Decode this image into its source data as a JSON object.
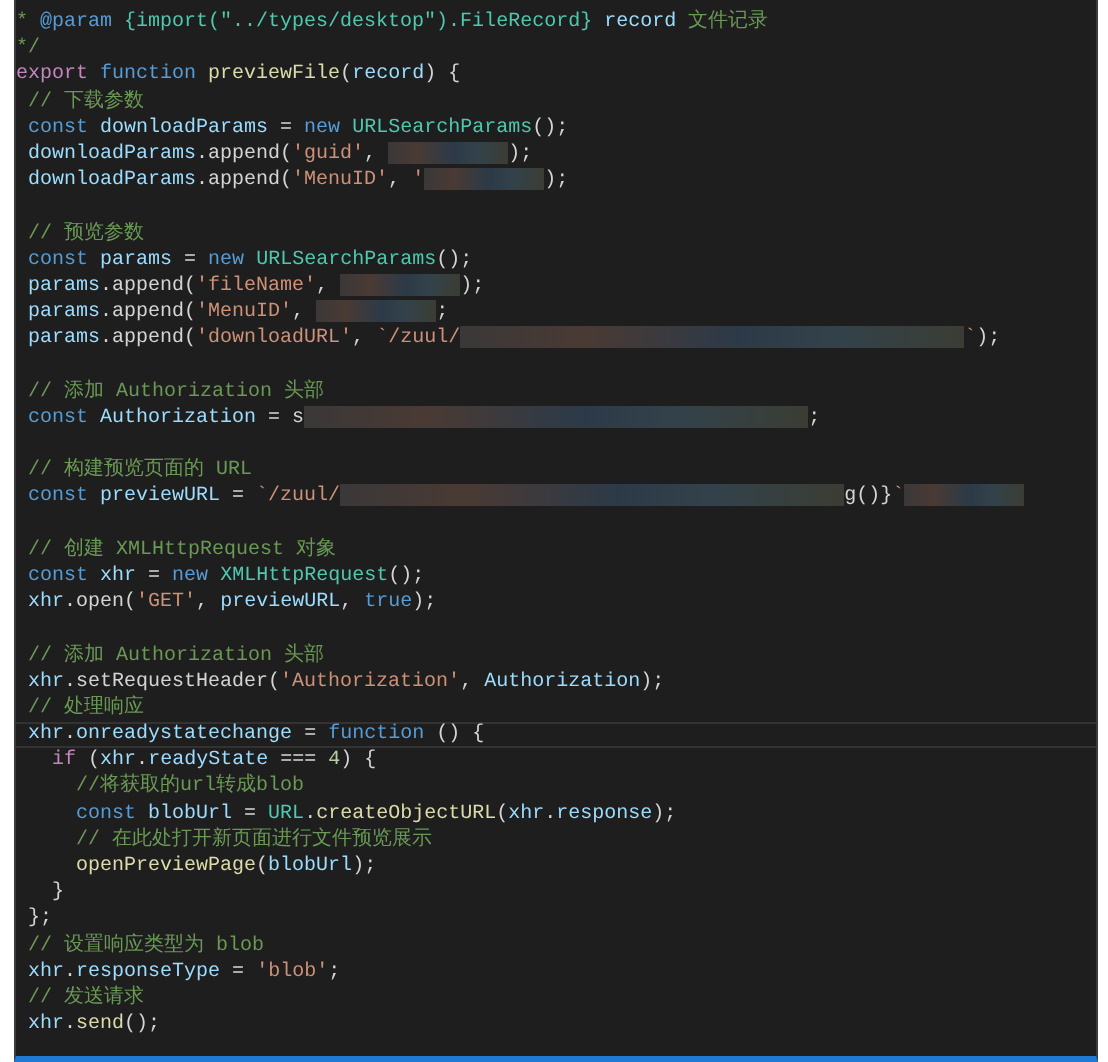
{
  "editor": {
    "lines": [
      {
        "kind": "code",
        "tokens": [
          {
            "kind": "c",
            "text": "* "
          },
          {
            "kind": "doc",
            "text": "@param"
          },
          {
            "kind": "type",
            "text": " {import(\"../types/desktop\").FileRecord}"
          },
          {
            "kind": "var",
            "text": " record"
          },
          {
            "kind": "c",
            "text": " 文件记录"
          }
        ]
      },
      {
        "kind": "code",
        "tokens": [
          {
            "kind": "c",
            "text": "*/"
          }
        ]
      },
      {
        "kind": "code",
        "tokens": [
          {
            "kind": "ctl",
            "text": "export"
          },
          {
            "kind": "kw",
            "text": " function"
          },
          {
            "kind": "fn",
            "text": " previewFile"
          },
          {
            "kind": "p",
            "text": "("
          },
          {
            "kind": "var",
            "text": "record"
          },
          {
            "kind": "p",
            "text": ") {"
          }
        ]
      },
      {
        "kind": "code",
        "tokens": [
          {
            "kind": "c",
            "text": " // 下载参数"
          }
        ]
      },
      {
        "kind": "code",
        "tokens": [
          {
            "kind": "kw",
            "text": " const"
          },
          {
            "kind": "var",
            "text": " downloadParams"
          },
          {
            "kind": "p",
            "text": " = "
          },
          {
            "kind": "kw",
            "text": "new"
          },
          {
            "kind": "cls",
            "text": " URLSearchParams"
          },
          {
            "kind": "p",
            "text": "();"
          }
        ]
      },
      {
        "kind": "code",
        "tokens": [
          {
            "kind": "var",
            "text": " downloadParams"
          },
          {
            "kind": "p",
            "text": ".append("
          },
          {
            "kind": "str",
            "text": "'guid'"
          },
          {
            "kind": "p",
            "text": ", "
          },
          {
            "kind": "blur"
          },
          {
            "kind": "p",
            "text": ");"
          }
        ]
      },
      {
        "kind": "code",
        "tokens": [
          {
            "kind": "var",
            "text": " downloadParams"
          },
          {
            "kind": "p",
            "text": ".append("
          },
          {
            "kind": "str",
            "text": "'MenuID'"
          },
          {
            "kind": "p",
            "text": ", "
          },
          {
            "kind": "str",
            "text": "'"
          },
          {
            "kind": "blur"
          },
          {
            "kind": "p",
            "text": ");"
          }
        ]
      },
      {
        "kind": "blank"
      },
      {
        "kind": "code",
        "tokens": [
          {
            "kind": "c",
            "text": " // 预览参数"
          }
        ]
      },
      {
        "kind": "code",
        "tokens": [
          {
            "kind": "kw",
            "text": " const"
          },
          {
            "kind": "var",
            "text": " params"
          },
          {
            "kind": "p",
            "text": " = "
          },
          {
            "kind": "kw",
            "text": "new"
          },
          {
            "kind": "cls",
            "text": " URLSearchParams"
          },
          {
            "kind": "p",
            "text": "();"
          }
        ]
      },
      {
        "kind": "code",
        "tokens": [
          {
            "kind": "var",
            "text": " params"
          },
          {
            "kind": "p",
            "text": ".append("
          },
          {
            "kind": "str",
            "text": "'fileName'"
          },
          {
            "kind": "p",
            "text": ", "
          },
          {
            "kind": "blur"
          },
          {
            "kind": "p",
            "text": ");"
          }
        ]
      },
      {
        "kind": "code",
        "tokens": [
          {
            "kind": "var",
            "text": " params"
          },
          {
            "kind": "p",
            "text": ".append("
          },
          {
            "kind": "str",
            "text": "'MenuID'"
          },
          {
            "kind": "p",
            "text": ", "
          },
          {
            "kind": "blur"
          },
          {
            "kind": "p",
            "text": ";"
          }
        ]
      },
      {
        "kind": "code",
        "tokens": [
          {
            "kind": "var",
            "text": " params"
          },
          {
            "kind": "p",
            "text": ".append("
          },
          {
            "kind": "str",
            "text": "'downloadURL'"
          },
          {
            "kind": "p",
            "text": ", "
          },
          {
            "kind": "str",
            "text": "`/zuul/"
          },
          {
            "kind": "wideblur"
          },
          {
            "kind": "str",
            "text": "`"
          },
          {
            "kind": "p",
            "text": ");"
          }
        ]
      },
      {
        "kind": "blank"
      },
      {
        "kind": "code",
        "tokens": [
          {
            "kind": "c",
            "text": " // 添加 Authorization 头部"
          }
        ]
      },
      {
        "kind": "code",
        "tokens": [
          {
            "kind": "kw",
            "text": " const"
          },
          {
            "kind": "var",
            "text": " Authorization"
          },
          {
            "kind": "p",
            "text": " = s"
          },
          {
            "kind": "wideblur"
          },
          {
            "kind": "p",
            "text": ";"
          }
        ]
      },
      {
        "kind": "blank"
      },
      {
        "kind": "code",
        "tokens": [
          {
            "kind": "c",
            "text": " // 构建预览页面的 URL"
          }
        ]
      },
      {
        "kind": "code",
        "tokens": [
          {
            "kind": "kw",
            "text": " const"
          },
          {
            "kind": "var",
            "text": " previewURL"
          },
          {
            "kind": "p",
            "text": " = "
          },
          {
            "kind": "str",
            "text": "`/zuul/"
          },
          {
            "kind": "wideblur"
          },
          {
            "kind": "p",
            "text": "g()}"
          },
          {
            "kind": "str",
            "text": "`"
          },
          {
            "kind": "blur"
          }
        ]
      },
      {
        "kind": "blank"
      },
      {
        "kind": "code",
        "tokens": [
          {
            "kind": "c",
            "text": " // 创建 XMLHttpRequest 对象"
          }
        ]
      },
      {
        "kind": "code",
        "tokens": [
          {
            "kind": "kw",
            "text": " const"
          },
          {
            "kind": "var",
            "text": " xhr"
          },
          {
            "kind": "p",
            "text": " = "
          },
          {
            "kind": "kw",
            "text": "new"
          },
          {
            "kind": "cls",
            "text": " XMLHttpRequest"
          },
          {
            "kind": "p",
            "text": "();"
          }
        ]
      },
      {
        "kind": "code",
        "tokens": [
          {
            "kind": "var",
            "text": " xhr"
          },
          {
            "kind": "p",
            "text": ".open("
          },
          {
            "kind": "str",
            "text": "'GET'"
          },
          {
            "kind": "p",
            "text": ", "
          },
          {
            "kind": "var",
            "text": "previewURL"
          },
          {
            "kind": "p",
            "text": ", "
          },
          {
            "kind": "kw",
            "text": "true"
          },
          {
            "kind": "p",
            "text": ");"
          }
        ]
      },
      {
        "kind": "blank"
      },
      {
        "kind": "code",
        "tokens": [
          {
            "kind": "c",
            "text": " // 添加 Authorization 头部"
          }
        ]
      },
      {
        "kind": "code",
        "tokens": [
          {
            "kind": "var",
            "text": " xhr"
          },
          {
            "kind": "p",
            "text": ".setRequestHeader("
          },
          {
            "kind": "str",
            "text": "'Authorization'"
          },
          {
            "kind": "p",
            "text": ", "
          },
          {
            "kind": "var",
            "text": "Authorization"
          },
          {
            "kind": "p",
            "text": ");"
          }
        ]
      },
      {
        "kind": "code",
        "tokens": [
          {
            "kind": "c",
            "text": " // 处理响应"
          }
        ]
      },
      {
        "kind": "code",
        "current": true,
        "tokens": [
          {
            "kind": "var",
            "text": " xhr"
          },
          {
            "kind": "p",
            "text": "."
          },
          {
            "kind": "var",
            "text": "onreadystatechange"
          },
          {
            "kind": "p",
            "text": " = "
          },
          {
            "kind": "kw",
            "text": "function"
          },
          {
            "kind": "p",
            "text": " () {"
          }
        ]
      },
      {
        "kind": "code",
        "tokens": [
          {
            "kind": "ctl",
            "text": "   if"
          },
          {
            "kind": "p",
            "text": " ("
          },
          {
            "kind": "var",
            "text": "xhr"
          },
          {
            "kind": "p",
            "text": "."
          },
          {
            "kind": "var",
            "text": "readyState"
          },
          {
            "kind": "p",
            "text": " === "
          },
          {
            "kind": "num",
            "text": "4"
          },
          {
            "kind": "p",
            "text": ") {"
          }
        ]
      },
      {
        "kind": "code",
        "tokens": [
          {
            "kind": "c",
            "text": "     //将获取的url转成blob"
          }
        ]
      },
      {
        "kind": "code",
        "tokens": [
          {
            "kind": "kw",
            "text": "     const"
          },
          {
            "kind": "var",
            "text": " blobUrl"
          },
          {
            "kind": "p",
            "text": " = "
          },
          {
            "kind": "cls",
            "text": "URL"
          },
          {
            "kind": "p",
            "text": "."
          },
          {
            "kind": "fn",
            "text": "createObjectURL"
          },
          {
            "kind": "p",
            "text": "("
          },
          {
            "kind": "var",
            "text": "xhr"
          },
          {
            "kind": "p",
            "text": "."
          },
          {
            "kind": "var",
            "text": "response"
          },
          {
            "kind": "p",
            "text": ");"
          }
        ]
      },
      {
        "kind": "code",
        "tokens": [
          {
            "kind": "c",
            "text": "     // 在此处打开新页面进行文件预览展示"
          }
        ]
      },
      {
        "kind": "code",
        "tokens": [
          {
            "kind": "fn",
            "text": "     openPreviewPage"
          },
          {
            "kind": "p",
            "text": "("
          },
          {
            "kind": "var",
            "text": "blobUrl"
          },
          {
            "kind": "p",
            "text": ");"
          }
        ]
      },
      {
        "kind": "code",
        "tokens": [
          {
            "kind": "p",
            "text": "   }"
          }
        ]
      },
      {
        "kind": "code",
        "tokens": [
          {
            "kind": "p",
            "text": " };"
          }
        ]
      },
      {
        "kind": "code",
        "tokens": [
          {
            "kind": "c",
            "text": " // 设置响应类型为 blob"
          }
        ]
      },
      {
        "kind": "code",
        "tokens": [
          {
            "kind": "var",
            "text": " xhr"
          },
          {
            "kind": "p",
            "text": "."
          },
          {
            "kind": "var",
            "text": "responseType"
          },
          {
            "kind": "p",
            "text": " = "
          },
          {
            "kind": "str",
            "text": "'blob'"
          },
          {
            "kind": "p",
            "text": ";"
          }
        ]
      },
      {
        "kind": "code",
        "tokens": [
          {
            "kind": "c",
            "text": " // 发送请求"
          }
        ]
      },
      {
        "kind": "code",
        "tokens": [
          {
            "kind": "var",
            "text": " xhr"
          },
          {
            "kind": "p",
            "text": "."
          },
          {
            "kind": "fn",
            "text": "send"
          },
          {
            "kind": "p",
            "text": "();"
          }
        ]
      }
    ]
  }
}
